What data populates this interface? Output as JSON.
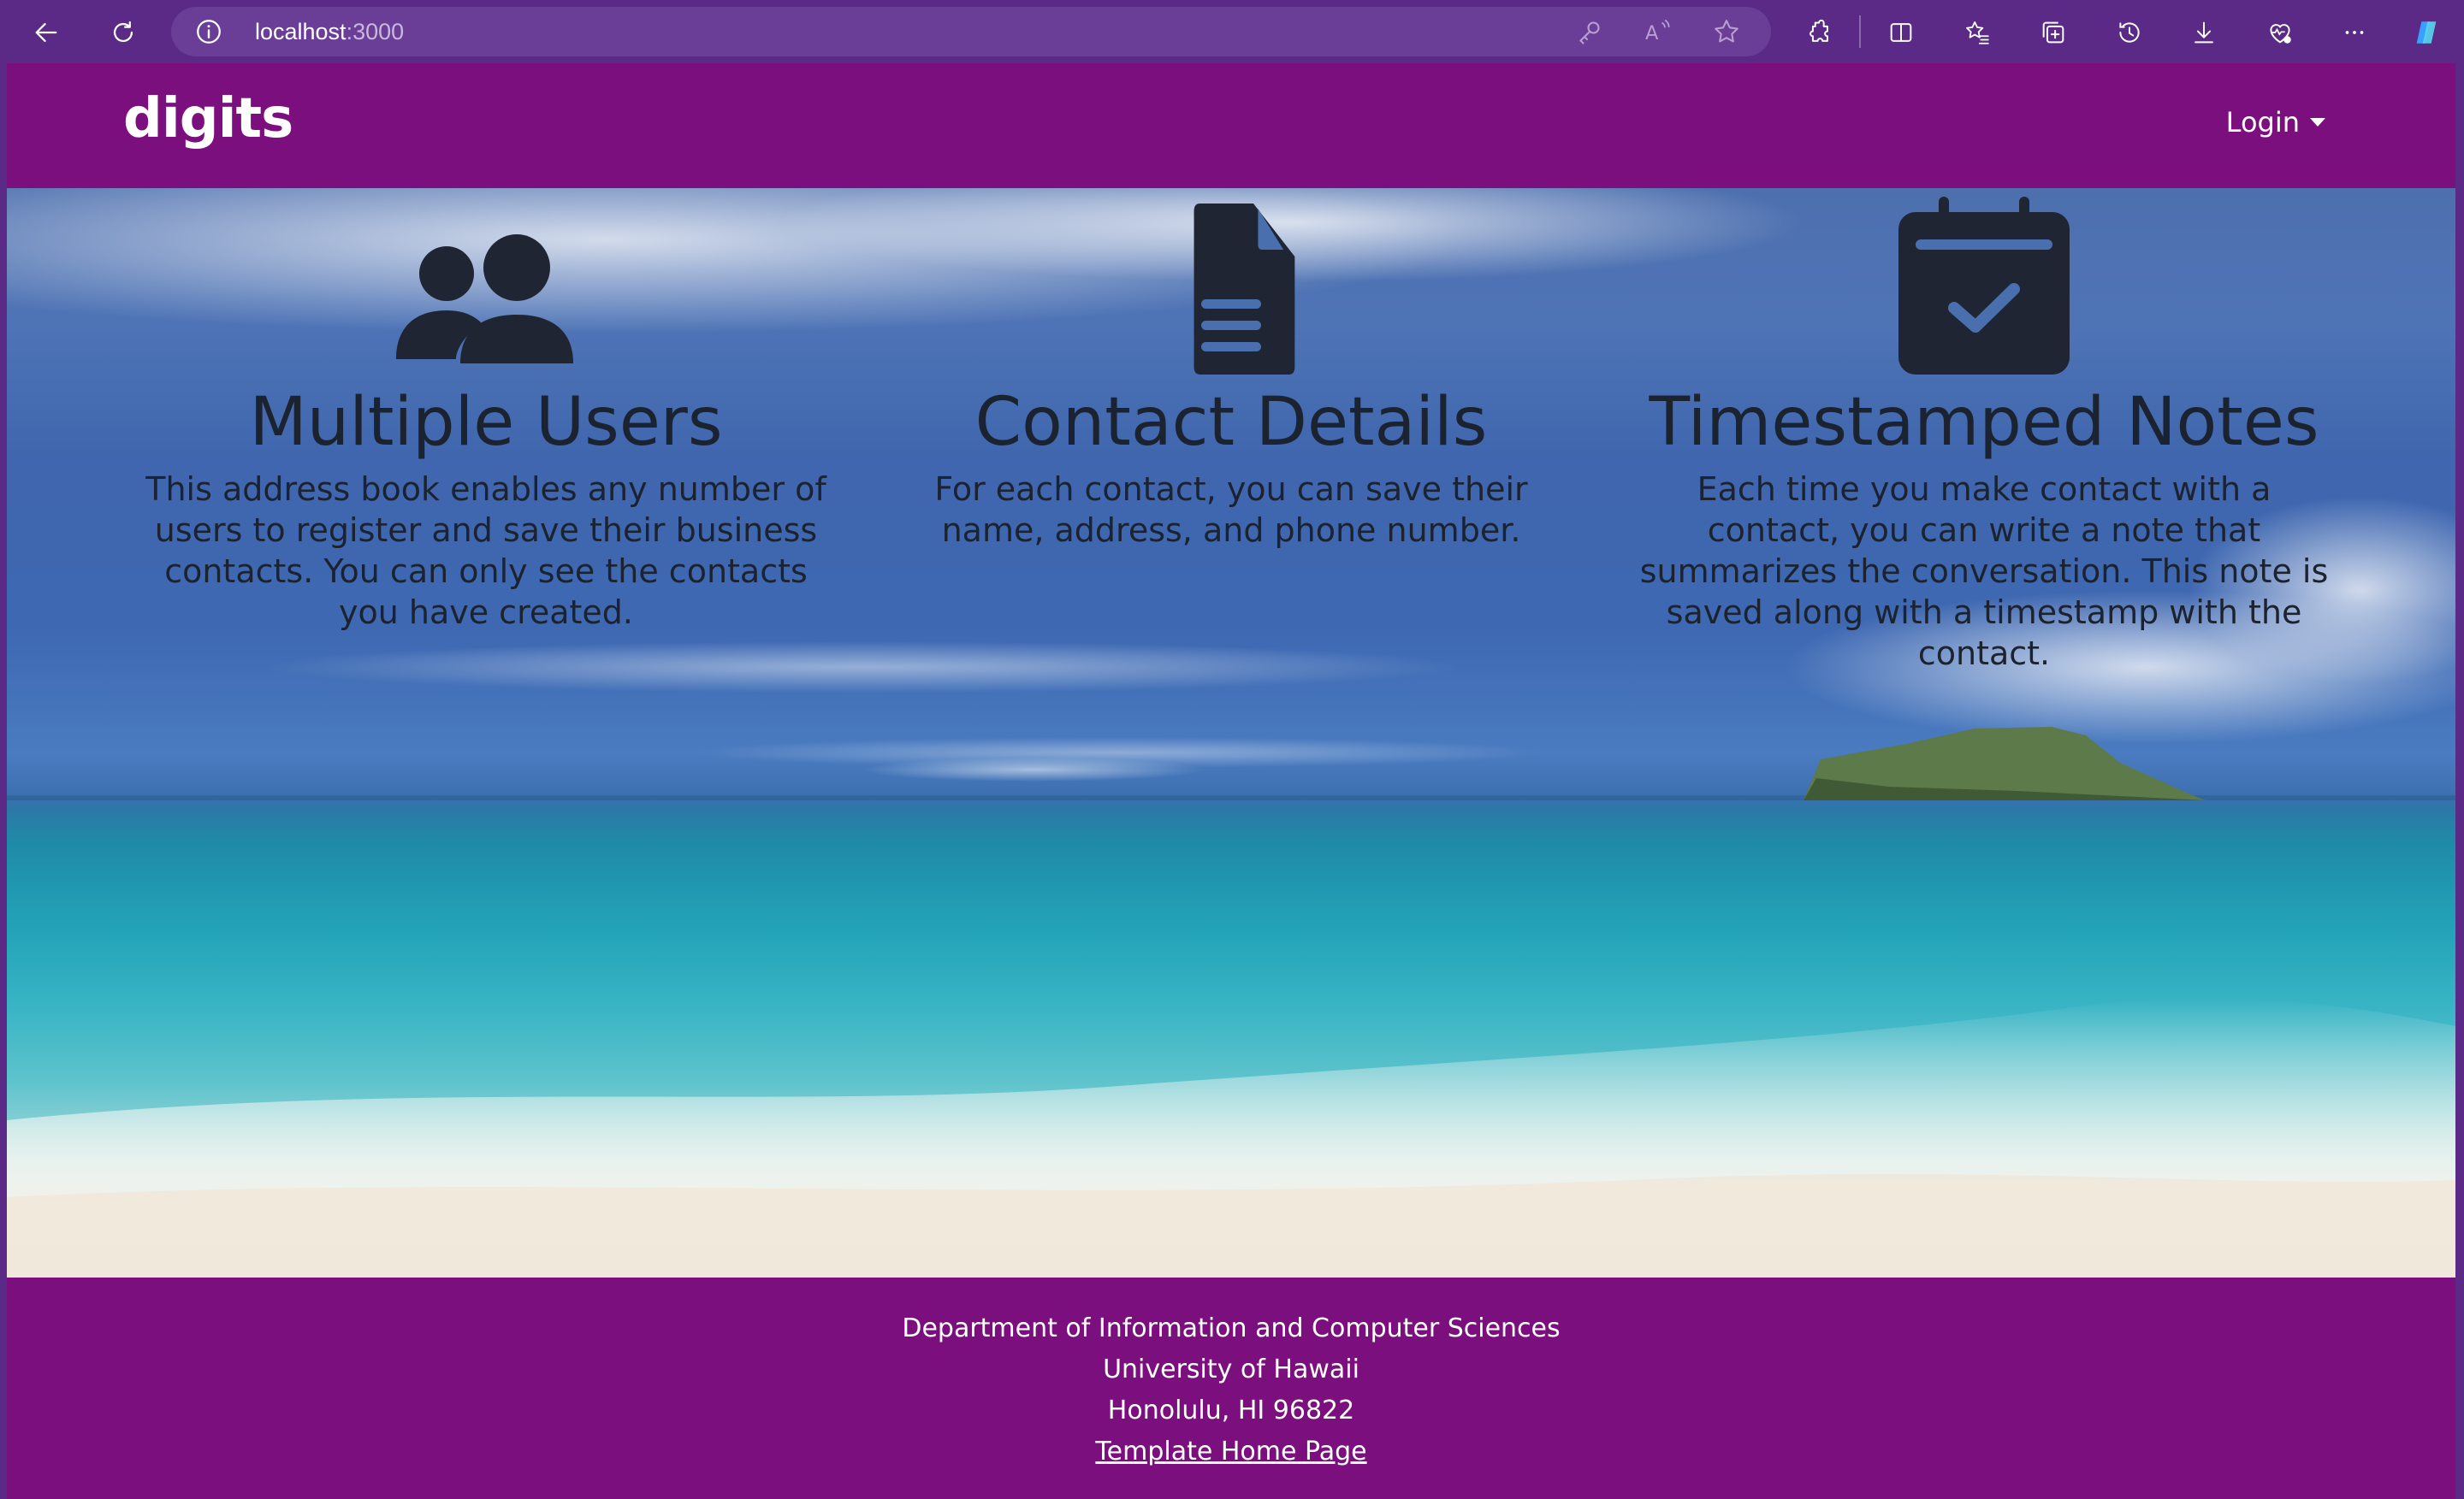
{
  "browser": {
    "url_host": "localhost",
    "url_port": ":3000"
  },
  "navbar": {
    "brand": "digits",
    "login_label": "Login"
  },
  "features": [
    {
      "icon": "users-icon",
      "title": "Multiple Users",
      "text": "This address book enables any number of users to register and save their business contacts. You can only see the contacts you have created."
    },
    {
      "icon": "file-text-icon",
      "title": "Contact Details",
      "text": "For each contact, you can save their name, address, and phone number."
    },
    {
      "icon": "calendar-check-icon",
      "title": "Timestamped Notes",
      "text": "Each time you make contact with a contact, you can write a note that summarizes the conversation. This note is saved along with a timestamp with the contact."
    }
  ],
  "footer": {
    "line1": "Department of Information and Computer Sciences",
    "line2": "University of Hawaii",
    "line3": "Honolulu, HI 96822",
    "link_label": "Template Home Page"
  },
  "colors": {
    "brand_purple": "#7b0f7d",
    "chrome_purple": "#5b2a86",
    "icon_dark": "#1f2532"
  }
}
